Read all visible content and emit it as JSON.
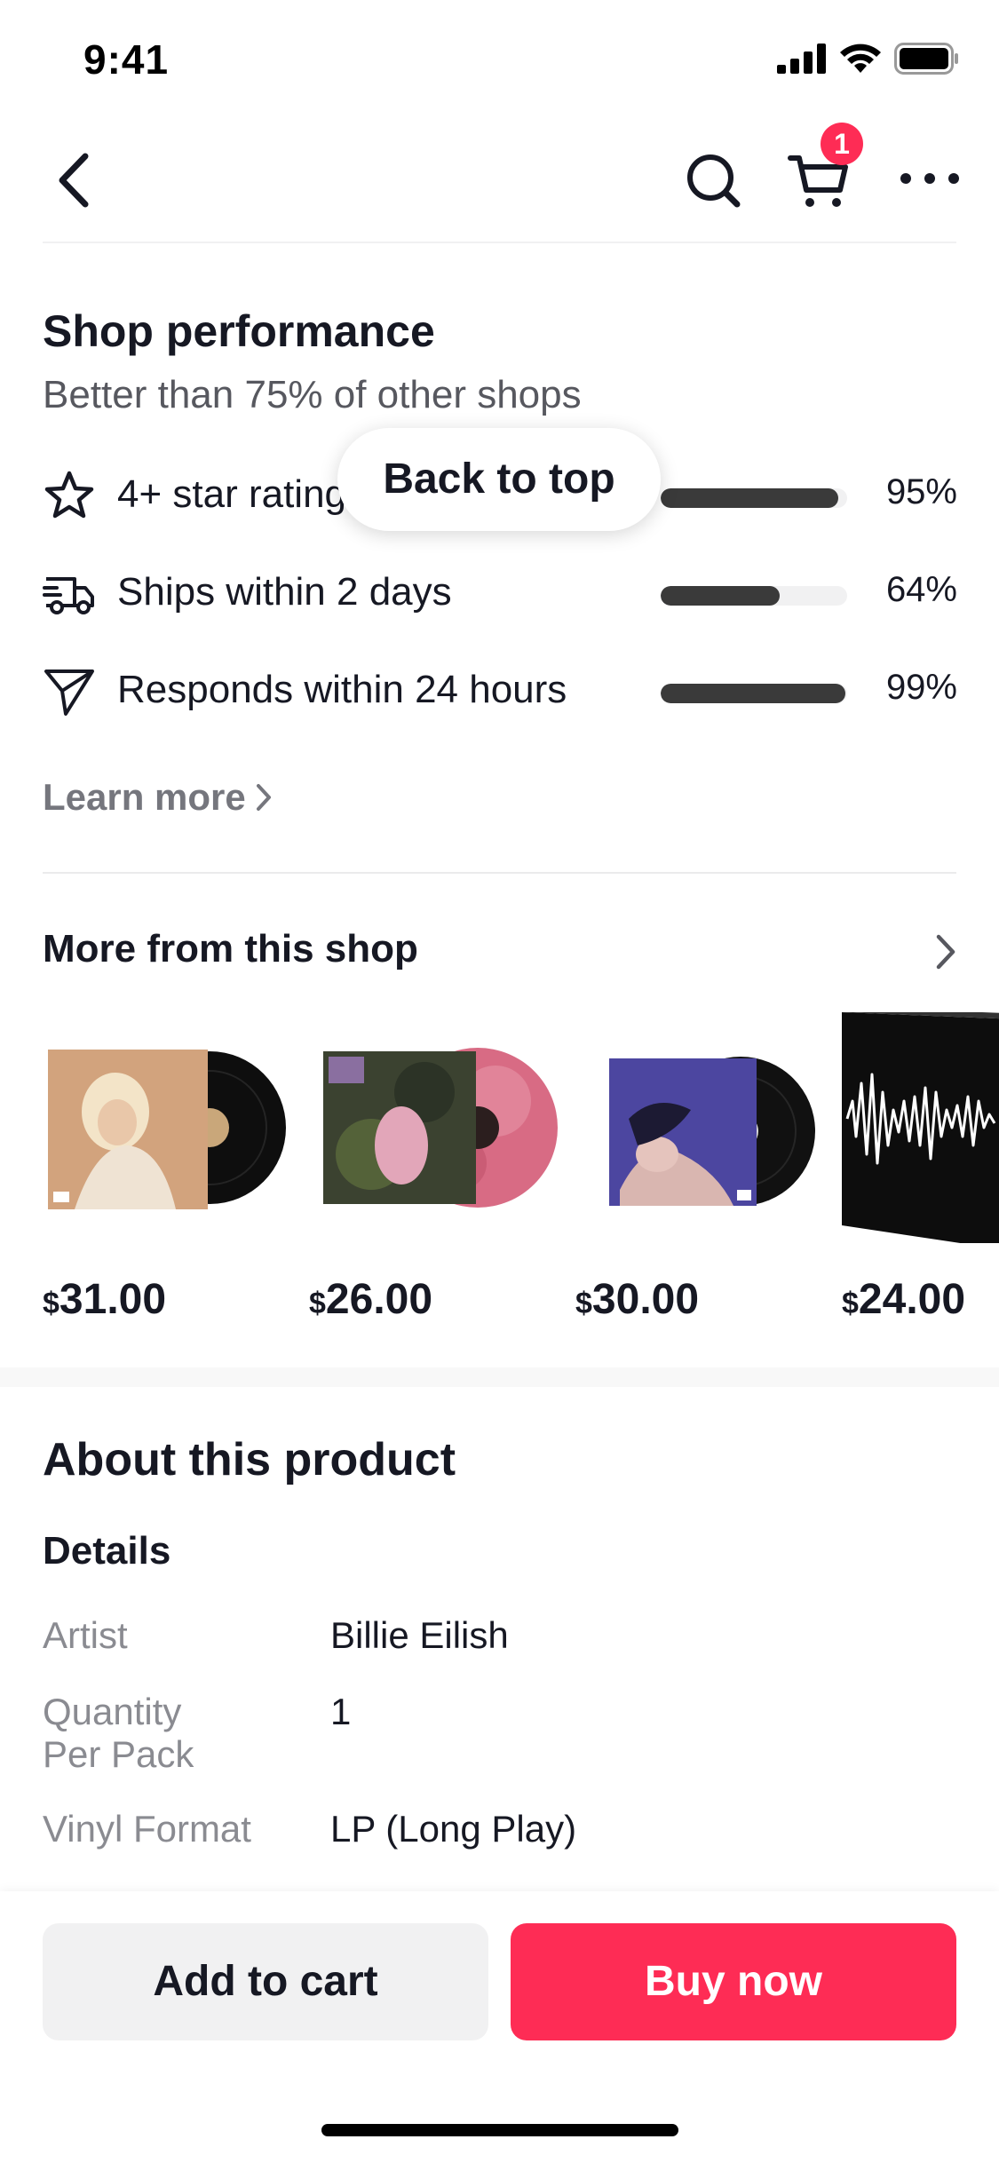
{
  "status_bar": {
    "time": "9:41"
  },
  "nav": {
    "cart_count": "1"
  },
  "shop_performance": {
    "title": "Shop performance",
    "subtitle": "Better than 75% of other shops",
    "metrics": [
      {
        "icon": "star-icon",
        "label": "4+ star rating",
        "value_text": "95%",
        "value": 95
      },
      {
        "icon": "truck-icon",
        "label": "Ships within 2 days",
        "value_text": "64%",
        "value": 64
      },
      {
        "icon": "send-icon",
        "label": "Responds within 24 hours",
        "value_text": "99%",
        "value": 99
      }
    ],
    "learn_more": "Learn more",
    "back_to_top": "Back to top"
  },
  "more_from_shop": {
    "title": "More from this shop",
    "products": [
      {
        "currency": "$",
        "price": "31.00"
      },
      {
        "currency": "$",
        "price": "26.00"
      },
      {
        "currency": "$",
        "price": "30.00"
      },
      {
        "currency": "$",
        "price": "24.00"
      }
    ]
  },
  "about": {
    "title": "About this product",
    "details_title": "Details",
    "details": [
      {
        "key": "Artist",
        "value": "Billie Eilish"
      },
      {
        "key": "Quantity\nPer Pack",
        "value": "1"
      },
      {
        "key": "Vinyl Format",
        "value": "LP (Long Play)"
      }
    ]
  },
  "actions": {
    "add_to_cart": "Add to cart",
    "buy_now": "Buy now"
  },
  "colors": {
    "accent": "#fe2c55",
    "bar_fill": "#3a3a3a",
    "bar_track": "#f1f1f2"
  }
}
